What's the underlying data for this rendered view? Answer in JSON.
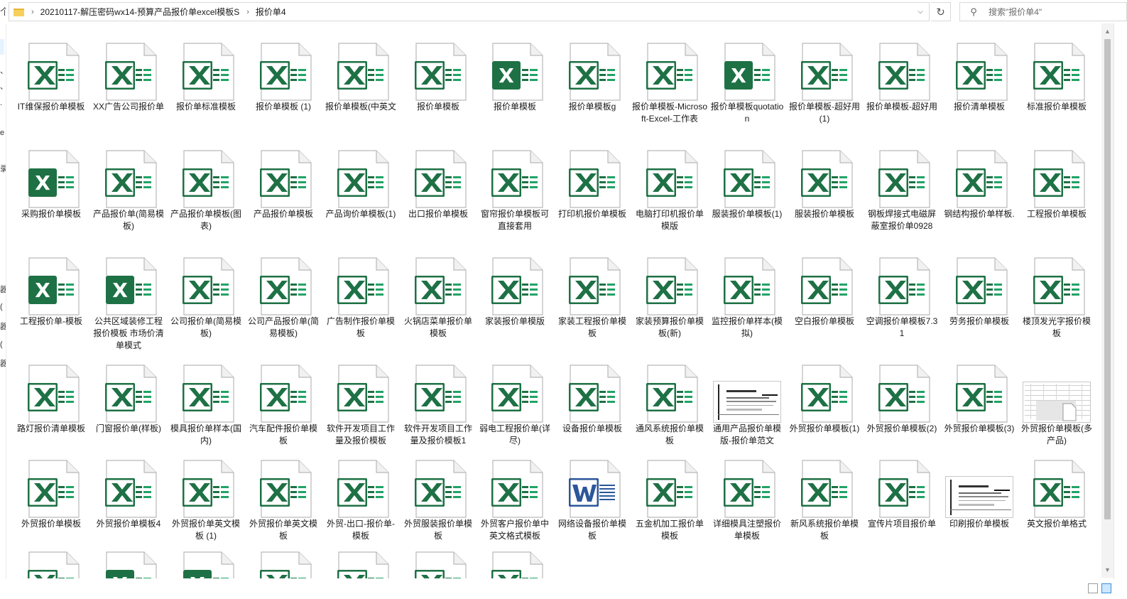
{
  "window": {
    "breadcrumb": [
      "20210117-解压密码wx14-预算产品报价单excel模板S",
      "报价单4"
    ],
    "breadcrumb_sep": "›",
    "search_placeholder": "搜索\"报价单4\"",
    "up_glyph": "个",
    "dropdown_glyph": "⌵",
    "refresh_glyph": "↻",
    "search_glyph": "⚲"
  },
  "navpane": {
    "glyphs": [
      "、",
      "、",
      ".",
      "e",
      "录",
      "器",
      "(",
      "器",
      "(",
      "器"
    ]
  },
  "colors": {
    "excel_green": "#1e7145",
    "excel_accent": "#21a366",
    "word_blue": "#2b579a",
    "folder_yellow": "#f7cf5b"
  },
  "files": [
    {
      "name": "IT维保报价单模板",
      "icon": "excel-file-icon"
    },
    {
      "name": "XX广告公司报价单",
      "icon": "excel-file-icon"
    },
    {
      "name": "报价单标准模板",
      "icon": "excel-file-icon"
    },
    {
      "name": "报价单模板 (1)",
      "icon": "excel-file-icon"
    },
    {
      "name": "报价单模板(中英文",
      "icon": "excel-file-icon"
    },
    {
      "name": "报价单模板",
      "icon": "excel-file-icon"
    },
    {
      "name": "报价单模板",
      "icon": "excel-file-solid-icon"
    },
    {
      "name": "报价单模板g",
      "icon": "excel-file-icon"
    },
    {
      "name": "报价单模板-Microsoft-Excel-工作表",
      "icon": "excel-file-icon"
    },
    {
      "name": "报价单模板quotation",
      "icon": "excel-file-solid-icon"
    },
    {
      "name": "报价单模板-超好用 (1)",
      "icon": "excel-file-icon"
    },
    {
      "name": "报价单模板-超好用",
      "icon": "excel-file-icon"
    },
    {
      "name": "报价清单模板",
      "icon": "excel-file-icon"
    },
    {
      "name": "标准报价单模板",
      "icon": "excel-file-icon"
    },
    {
      "name": "采购报价单模板",
      "icon": "excel-file-solid-icon"
    },
    {
      "name": "产品报价单(简易模板)",
      "icon": "excel-file-icon"
    },
    {
      "name": "产品报价单模板(图表)",
      "icon": "excel-file-icon"
    },
    {
      "name": "产品报价单模板",
      "icon": "excel-file-icon"
    },
    {
      "name": "产品询价单模板(1)",
      "icon": "excel-file-icon"
    },
    {
      "name": "出口报价单模板",
      "icon": "excel-file-icon"
    },
    {
      "name": "窗帘报价单模板可直接套用",
      "icon": "excel-file-icon"
    },
    {
      "name": "打印机报价单模板",
      "icon": "excel-file-icon"
    },
    {
      "name": "电脑打印机报价单模版",
      "icon": "excel-file-icon"
    },
    {
      "name": "服装报价单模板(1)",
      "icon": "excel-file-icon"
    },
    {
      "name": "服装报价单模板",
      "icon": "excel-file-icon"
    },
    {
      "name": "钢板焊接式电磁屏蔽室报价单0928",
      "icon": "excel-file-icon"
    },
    {
      "name": "钢结构报价单样板.",
      "icon": "excel-file-icon"
    },
    {
      "name": "工程报价单模板",
      "icon": "excel-file-icon"
    },
    {
      "name": "工程报价单-模板",
      "icon": "excel-file-solid-icon"
    },
    {
      "name": "公共区域装修工程报价模板 市场价清单模式",
      "icon": "excel-file-solid-icon"
    },
    {
      "name": "公司报价单(简易模板)",
      "icon": "excel-file-icon"
    },
    {
      "name": "公司产品报价单(简易模板)",
      "icon": "excel-file-icon"
    },
    {
      "name": "广告制作报价单模板",
      "icon": "excel-file-icon"
    },
    {
      "name": "火锅店菜单报价单模板",
      "icon": "excel-file-icon"
    },
    {
      "name": "家装报价单模版",
      "icon": "excel-file-icon"
    },
    {
      "name": "家装工程报价单模板",
      "icon": "excel-file-icon"
    },
    {
      "name": "家装预算报价单模板(新)",
      "icon": "excel-file-icon"
    },
    {
      "name": "监控报价单样本(模拟)",
      "icon": "excel-file-icon"
    },
    {
      "name": "空白报价单模板",
      "icon": "excel-file-icon"
    },
    {
      "name": "空调报价单模板7.31",
      "icon": "excel-file-icon"
    },
    {
      "name": "劳务报价单模板",
      "icon": "excel-file-icon"
    },
    {
      "name": "楼顶发光字报价模板",
      "icon": "excel-file-icon"
    },
    {
      "name": "路灯报价清单模板",
      "icon": "excel-file-icon"
    },
    {
      "name": "门窗报价单(样板)",
      "icon": "excel-file-icon"
    },
    {
      "name": "模具报价单样本(国内)",
      "icon": "excel-file-icon"
    },
    {
      "name": "汽车配件报价单模板",
      "icon": "excel-file-icon"
    },
    {
      "name": "软件开发项目工作量及报价模板",
      "icon": "excel-file-icon"
    },
    {
      "name": "软件开发项目工作量及报价模板1",
      "icon": "excel-file-icon"
    },
    {
      "name": "弱电工程报价单(详尽)",
      "icon": "excel-file-icon"
    },
    {
      "name": "设备报价单模板",
      "icon": "excel-file-icon"
    },
    {
      "name": "通风系统报价单模板",
      "icon": "excel-file-icon"
    },
    {
      "name": "通用产品报价单模版-报价单范文",
      "icon": "document-preview-icon"
    },
    {
      "name": "外贸报价单模板(1)",
      "icon": "excel-file-icon"
    },
    {
      "name": "外贸报价单模板(2)",
      "icon": "excel-file-icon"
    },
    {
      "name": "外贸报价单模板(3)",
      "icon": "excel-file-icon"
    },
    {
      "name": "外贸报价单模板(多产品)",
      "icon": "spreadsheet-preview-icon"
    },
    {
      "name": "外贸报价单模板",
      "icon": "excel-file-icon"
    },
    {
      "name": "外贸报价单模板4",
      "icon": "excel-file-icon"
    },
    {
      "name": "外贸报价单英文模板 (1)",
      "icon": "excel-file-icon"
    },
    {
      "name": "外贸报价单英文模板",
      "icon": "excel-file-icon"
    },
    {
      "name": "外贸-出口-报价单-模板",
      "icon": "excel-file-icon"
    },
    {
      "name": "外贸服装报价单模板",
      "icon": "excel-file-icon"
    },
    {
      "name": "外贸客户报价单中英文格式模板",
      "icon": "excel-file-icon"
    },
    {
      "name": "网络设备报价单模板",
      "icon": "word-file-icon"
    },
    {
      "name": "五金机加工报价单模板",
      "icon": "excel-file-icon"
    },
    {
      "name": "详细模具注塑报价单模板",
      "icon": "excel-file-icon"
    },
    {
      "name": "新风系统报价单模板",
      "icon": "excel-file-icon"
    },
    {
      "name": "宣传片项目报价单",
      "icon": "excel-file-icon"
    },
    {
      "name": "印刷报价单模板",
      "icon": "document-preview-icon"
    },
    {
      "name": "英文报价单格式",
      "icon": "excel-file-icon"
    },
    {
      "name": "",
      "icon": "excel-file-icon"
    },
    {
      "name": "",
      "icon": "excel-file-solid-icon"
    },
    {
      "name": "",
      "icon": "excel-file-solid-icon"
    },
    {
      "name": "",
      "icon": "excel-file-icon"
    },
    {
      "name": "",
      "icon": "excel-file-icon"
    },
    {
      "name": "",
      "icon": "excel-file-icon"
    },
    {
      "name": "",
      "icon": "excel-file-icon"
    }
  ]
}
